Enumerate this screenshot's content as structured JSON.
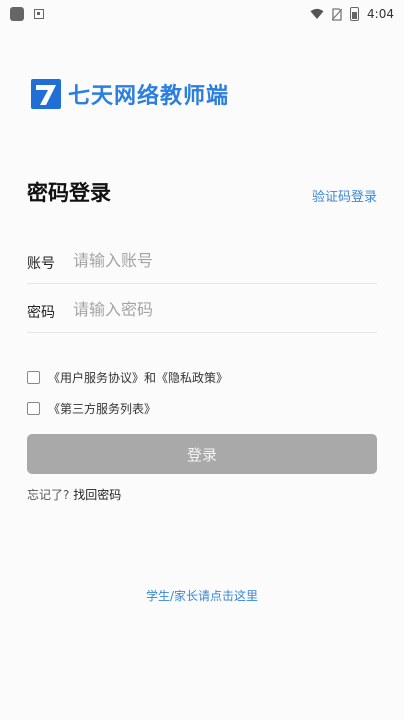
{
  "status_bar": {
    "time": "4:04"
  },
  "logo": {
    "text": "七天网络教师端"
  },
  "header": {
    "title": "密码登录",
    "code_login": "验证码登录"
  },
  "form": {
    "account_label": "账号",
    "account_placeholder": "请输入账号",
    "password_label": "密码",
    "password_placeholder": "请输入密码"
  },
  "agreements": {
    "row1_user": "《用户服务协议》",
    "row1_and": "和",
    "row1_privacy": "《隐私政策》",
    "row2": "《第三方服务列表》"
  },
  "login_button": "登录",
  "forgot": {
    "prefix": "忘记了?",
    "link": "找回密码"
  },
  "student_link": "学生/家长请点击这里",
  "colors": {
    "brand": "#2a7fe0",
    "link": "#3a86d9",
    "button_disabled": "#a9a9a9"
  }
}
